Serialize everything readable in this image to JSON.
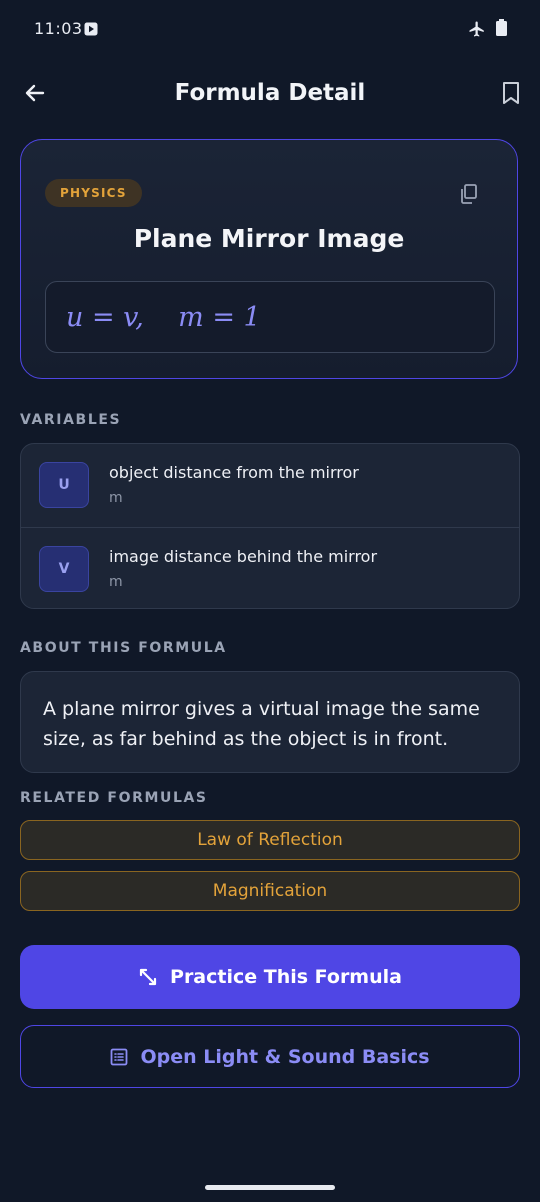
{
  "status_bar": {
    "time": "11:03",
    "icons": [
      "media-icon",
      "airplane-icon",
      "battery-icon"
    ]
  },
  "app_bar": {
    "title": "Formula Detail",
    "back_icon": "arrow-left-icon",
    "bookmark_icon": "bookmark-icon"
  },
  "formula": {
    "category": "PHYSICS",
    "title": "Plane Mirror Image",
    "expression": "u = v,    m = 1",
    "copy_icon": "copy-icon"
  },
  "variables": {
    "label": "VARIABLES",
    "items": [
      {
        "symbol": "U",
        "description": "object distance from the mirror",
        "unit": "m"
      },
      {
        "symbol": "V",
        "description": "image distance behind the mirror",
        "unit": "m"
      }
    ]
  },
  "about": {
    "label": "ABOUT THIS FORMULA",
    "text": "A plane mirror gives a virtual image the same size, as far behind as the object is in front."
  },
  "related": {
    "label": "RELATED FORMULAS",
    "items": [
      "Law of Reflection",
      "Magnification"
    ]
  },
  "actions": {
    "practice_label": "Practice This Formula",
    "open_label": "Open Light & Sound Basics"
  },
  "colors": {
    "background": "#101828",
    "accent": "#4f46e5",
    "accent_text": "#8b8cf5",
    "category": "#e3a33a"
  }
}
